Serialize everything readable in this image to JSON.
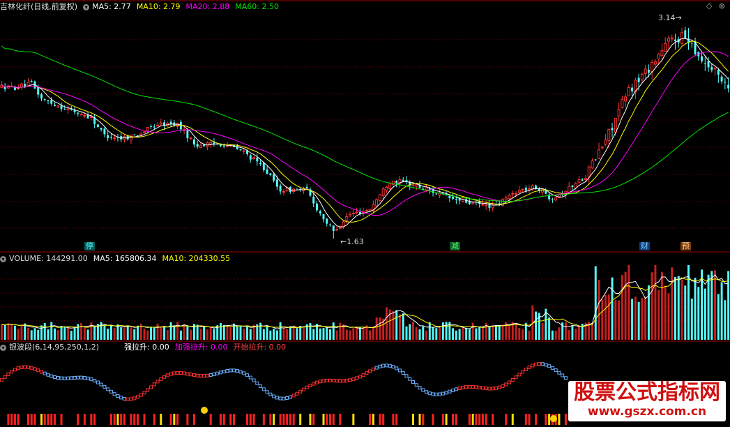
{
  "main_header": {
    "title": "吉林化纤(日线,前复权)",
    "ma5": "MA5: 2.77",
    "ma10": "MA10: 2.79",
    "ma20": "MA20: 2.88",
    "ma60": "MA60: 2.50"
  },
  "volume_header": {
    "volume": "VOLUME: 144291.00",
    "ma5": "MA5: 165806.34",
    "ma10": "MA10: 204330.55"
  },
  "indicator_header": {
    "name": "银波段(6,14,95,250,1,2)",
    "strong": "强拉升: 0.00",
    "boost": "加强拉升: 0.00",
    "start": "开始拉升: 0.00"
  },
  "price_labels": {
    "high": "3.14",
    "low": "1.63"
  },
  "event_markers": {
    "stop": "停",
    "cut": "减",
    "finance": "财",
    "forecast": "预"
  },
  "top_icons": "◇ ⊕",
  "watermark": {
    "title": "股票公式指标网",
    "url": "www.gszx.com.cn"
  },
  "colors": {
    "up": "#ff3232",
    "down": "#54fcfc",
    "ma5": "#ffffff",
    "ma10": "#ffff00",
    "ma20": "#ff00ff",
    "ma60": "#00e600",
    "grid": "#7a0000"
  },
  "price_series": {
    "anchors": [
      [
        0,
        2.72
      ],
      [
        20,
        2.71
      ],
      [
        45,
        2.74
      ],
      [
        60,
        2.63
      ],
      [
        100,
        2.55
      ],
      [
        130,
        2.5
      ],
      [
        150,
        2.37
      ],
      [
        175,
        2.35
      ],
      [
        200,
        2.38
      ],
      [
        225,
        2.45
      ],
      [
        255,
        2.45
      ],
      [
        280,
        2.3
      ],
      [
        320,
        2.31
      ],
      [
        350,
        2.25
      ],
      [
        380,
        2.13
      ],
      [
        400,
        1.98
      ],
      [
        440,
        1.98
      ],
      [
        455,
        1.84
      ],
      [
        478,
        1.68
      ],
      [
        500,
        1.8
      ],
      [
        530,
        1.84
      ],
      [
        560,
        2.05
      ],
      [
        590,
        2.02
      ],
      [
        620,
        1.97
      ],
      [
        650,
        1.91
      ],
      [
        680,
        1.88
      ],
      [
        710,
        1.86
      ],
      [
        740,
        1.97
      ],
      [
        770,
        2.0
      ],
      [
        790,
        1.92
      ],
      [
        810,
        1.97
      ],
      [
        840,
        2.08
      ],
      [
        870,
        2.35
      ],
      [
        900,
        2.68
      ],
      [
        930,
        2.85
      ],
      [
        960,
        3.05
      ],
      [
        985,
        3.08
      ],
      [
        1005,
        2.92
      ],
      [
        1047,
        2.72
      ]
    ]
  }
}
